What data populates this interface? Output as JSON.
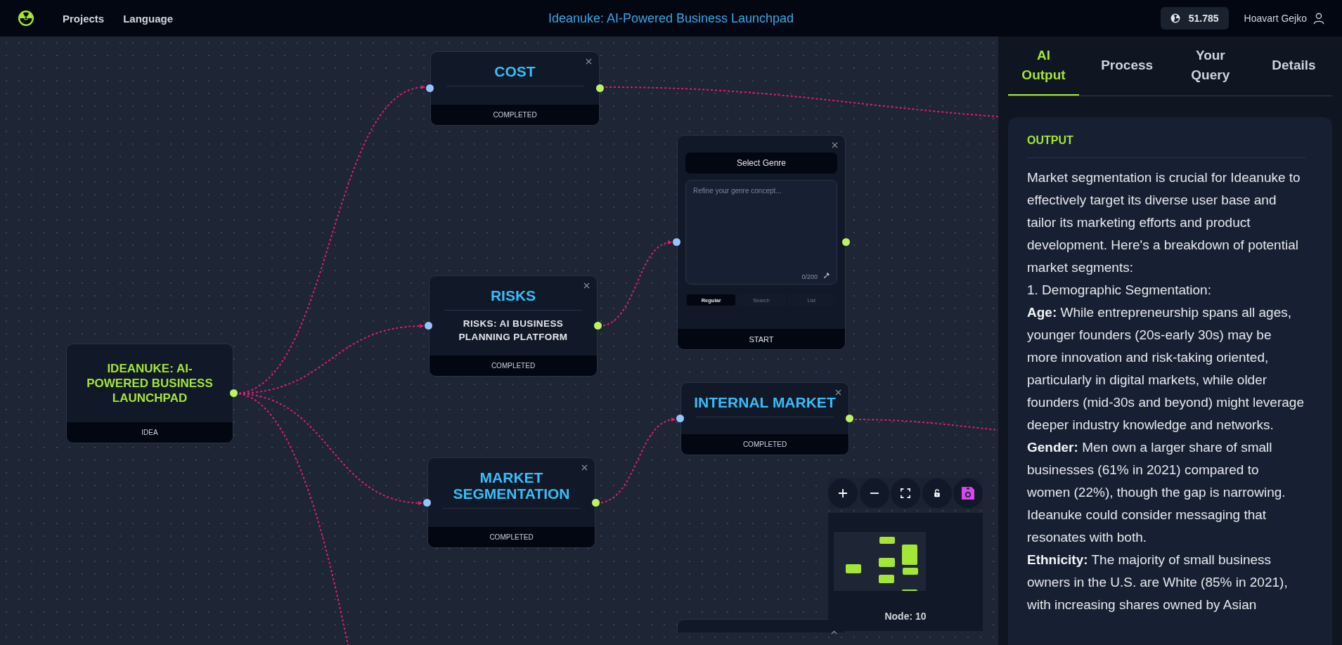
{
  "header": {
    "nav": [
      {
        "label": "Projects"
      },
      {
        "label": "Language"
      }
    ],
    "title": "Ideanuke: AI-Powered Business Launchpad",
    "credits": "51.785",
    "user": "Hoavart Gejko"
  },
  "canvas": {
    "nodes": [
      {
        "kind": "result",
        "title": "COST",
        "footer": "COMPLETED"
      },
      {
        "kind": "genre",
        "select": "Select Genre",
        "placeholder": "Refine your genre concept...",
        "counter": "0/200",
        "modes": [
          {
            "label": "Regular",
            "selected": true
          },
          {
            "label": "Search",
            "selected": false
          },
          {
            "label": "List",
            "selected": false
          }
        ],
        "footer": "START"
      },
      {
        "kind": "result",
        "title": "RISKS",
        "subtitle": "RISKS: AI BUSINESS PLANNING PLATFORM",
        "footer": "COMPLETED"
      },
      {
        "kind": "idea",
        "title": "IDEANUKE: AI-POWERED BUSINESS LAUNCHPAD",
        "footer": "IDEA"
      },
      {
        "kind": "result",
        "title": "INTERNAL MARKET",
        "footer": "COMPLETED"
      },
      {
        "kind": "result",
        "title": "MARKET SEGMENTATION",
        "footer": "COMPLETED"
      },
      {
        "kind": "partial"
      }
    ],
    "minimap": {
      "caption": "Node: 10"
    }
  },
  "panel": {
    "tabs": [
      {
        "label": "AI Output",
        "selected": true
      },
      {
        "label": "Process",
        "selected": false
      },
      {
        "label": "Your Query",
        "selected": false
      },
      {
        "label": "Details",
        "selected": false
      }
    ],
    "section": "OUTPUT",
    "paragraphs": [
      "Market segmentation is crucial for Ideanuke to effectively target its diverse user base and tailor its marketing efforts and product development. Here's a breakdown of potential market segments:",
      "1. Demographic Segmentation:",
      "**Age:** While entrepreneurship spans all ages, younger founders (20s-early 30s) may be more innovation and risk-taking oriented, particularly in digital markets, while older founders (mid-30s and beyond) might leverage deeper industry knowledge and networks.",
      "**Gender:** Men own a larger share of small businesses (61% in 2021) compared to women (22%), though the gap is narrowing. Ideanuke could consider messaging that resonates with both.",
      "**Ethnicity:** The majority of small business owners in the U.S. are White (85% in 2021), with increasing shares owned by Asian"
    ]
  }
}
